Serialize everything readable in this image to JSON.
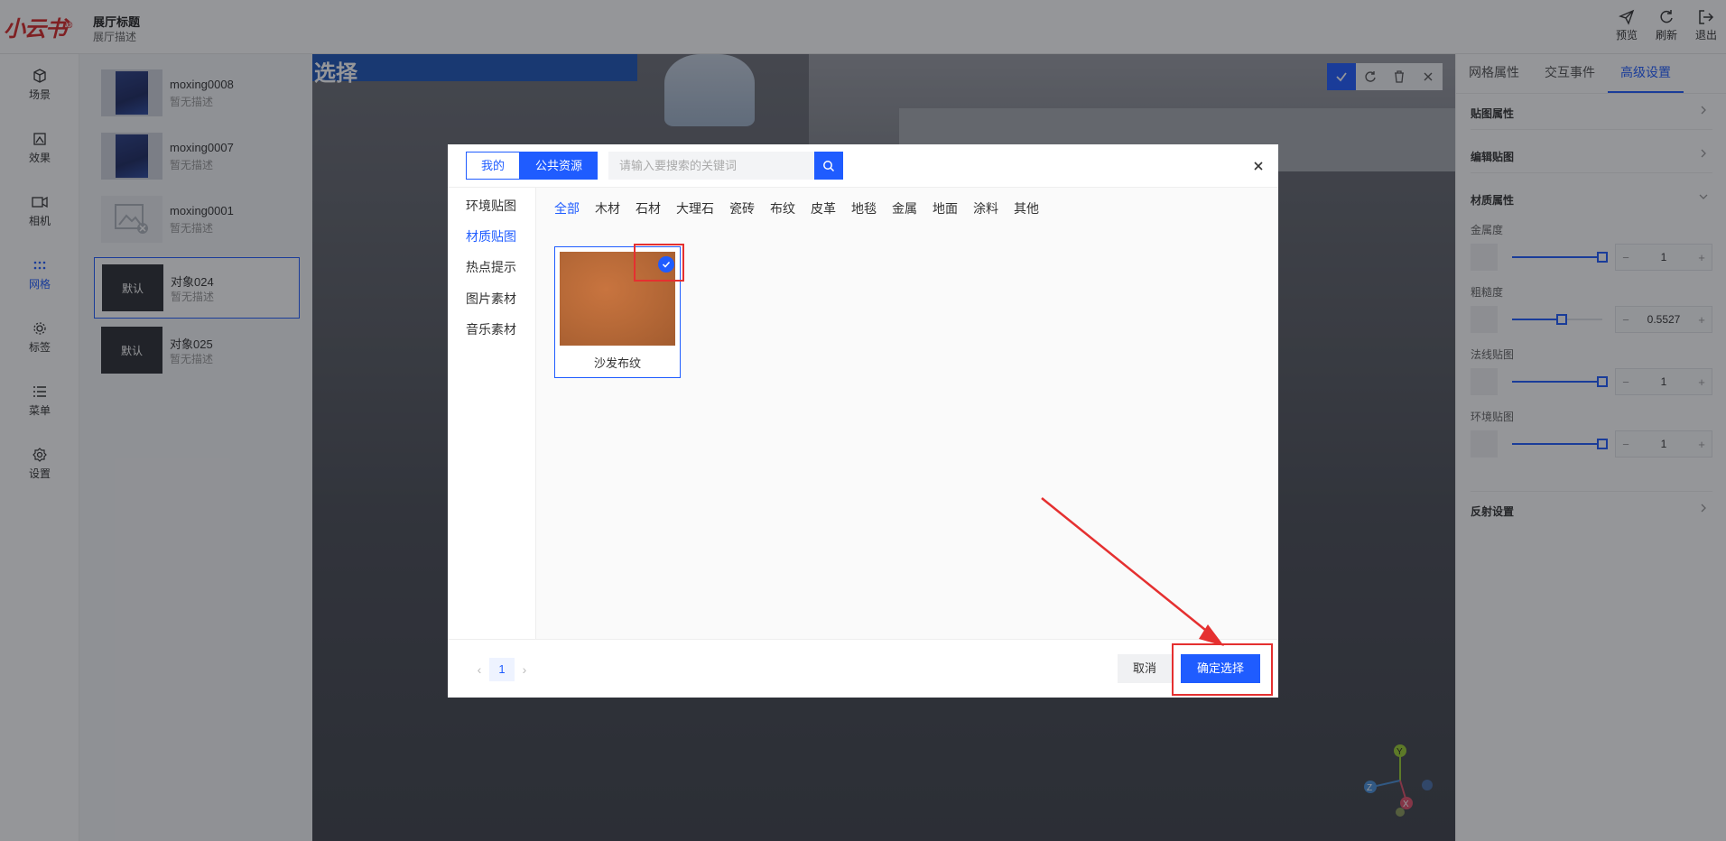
{
  "header": {
    "logo_text": "小云书",
    "logo_mark": "®",
    "hall_title": "展厅标题",
    "hall_desc": "展厅描述",
    "actions": [
      {
        "label": "预览",
        "icon": "send-icon"
      },
      {
        "label": "刷新",
        "icon": "refresh-icon"
      },
      {
        "label": "退出",
        "icon": "logout-icon"
      }
    ]
  },
  "nav": {
    "items": [
      {
        "label": "场景",
        "icon": "cube-icon"
      },
      {
        "label": "效果",
        "icon": "image-effect-icon"
      },
      {
        "label": "相机",
        "icon": "camera-icon"
      },
      {
        "label": "网格",
        "icon": "grid-dots-icon",
        "active": true
      },
      {
        "label": "标签",
        "icon": "tag-icon"
      },
      {
        "label": "菜单",
        "icon": "menu-list-icon"
      },
      {
        "label": "设置",
        "icon": "gear-icon"
      }
    ]
  },
  "objects": [
    {
      "name": "moxing0008",
      "desc": "暂无描述",
      "thumb": "book"
    },
    {
      "name": "moxing0007",
      "desc": "暂无描述",
      "thumb": "book"
    },
    {
      "name": "moxing0001",
      "desc": "暂无描述",
      "thumb": "broken-image"
    },
    {
      "name": "对象024",
      "desc": "暂无描述",
      "thumb": "default",
      "thumb_text": "默认",
      "selected": true
    },
    {
      "name": "对象025",
      "desc": "暂无描述",
      "thumb": "default",
      "thumb_text": "默认"
    }
  ],
  "viewport": {
    "wall_text": "选择"
  },
  "right_panel": {
    "tabs": [
      "网格属性",
      "交互事件",
      "高级设置"
    ],
    "active_tab": "高级设置",
    "sections": {
      "texture_props": "贴图属性",
      "edit_texture": "编辑贴图",
      "material_props": "材质属性",
      "reflection": "反射设置"
    },
    "props": [
      {
        "label": "金属度",
        "value": "1",
        "level": 1.0
      },
      {
        "label": "粗糙度",
        "value": "0.5527",
        "level": 0.5527
      },
      {
        "label": "法线贴图",
        "value": "1",
        "level": 1.0
      },
      {
        "label": "环境贴图",
        "value": "1",
        "level": 1.0
      }
    ]
  },
  "modal": {
    "tabs": [
      "我的",
      "公共资源"
    ],
    "active_tab": "公共资源",
    "search_placeholder": "请输入要搜索的关键词",
    "side_items": [
      "环境贴图",
      "材质贴图",
      "热点提示",
      "图片素材",
      "音乐素材"
    ],
    "active_side": "材质贴图",
    "categories": [
      "全部",
      "木材",
      "石材",
      "大理石",
      "瓷砖",
      "布纹",
      "皮革",
      "地毯",
      "金属",
      "地面",
      "涂料",
      "其他"
    ],
    "active_category": "全部",
    "items": [
      {
        "name": "沙发布纹",
        "selected": true
      }
    ],
    "pager": {
      "current": "1",
      "prev": "‹",
      "next": "›"
    },
    "cancel_label": "取消",
    "confirm_label": "确定选择"
  },
  "colors": {
    "primary": "#1f5cff",
    "annotation": "#e53030",
    "logo": "#d72828"
  }
}
